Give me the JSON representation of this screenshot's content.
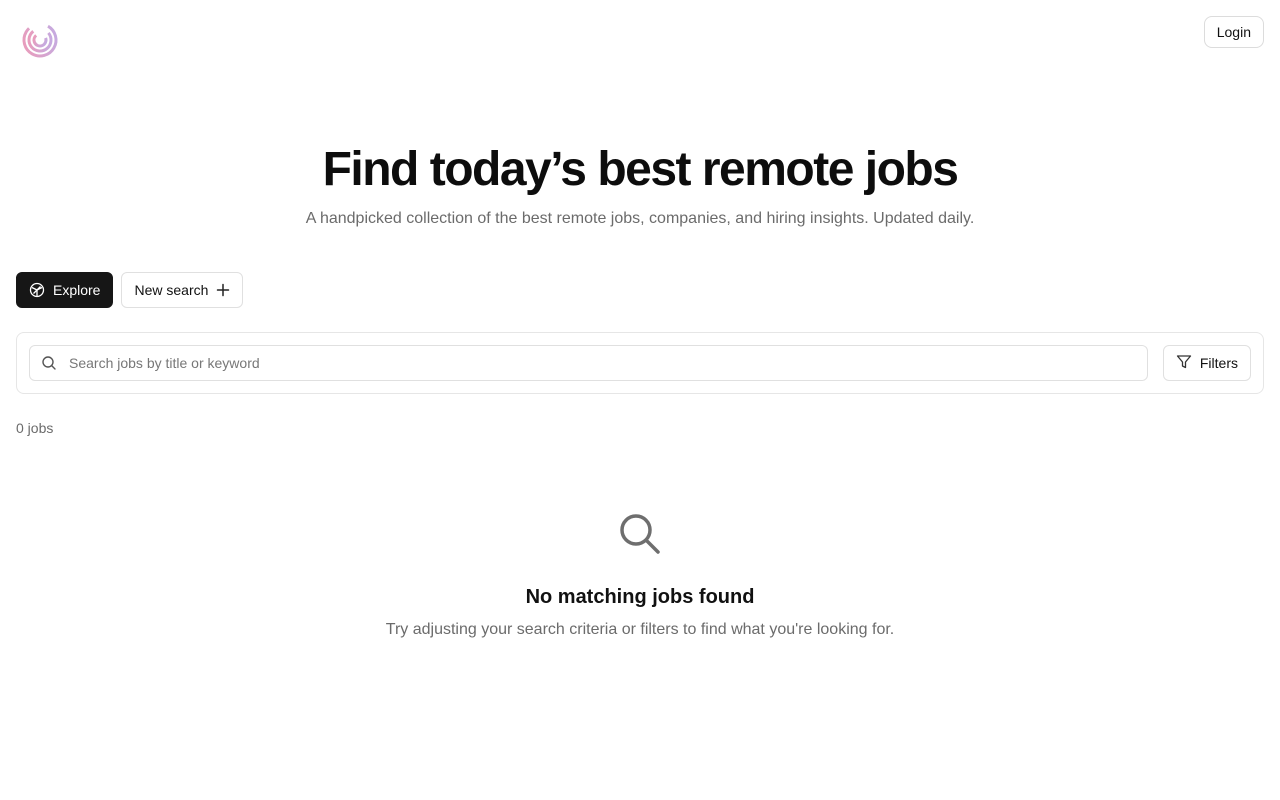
{
  "header": {
    "logo_icon": "concentric-swirl-logo",
    "login_label": "Login"
  },
  "hero": {
    "title": "Find today’s best remote jobs",
    "subtitle": "A handpicked collection of the best remote jobs, companies, and hiring insights. Updated daily."
  },
  "tabs": [
    {
      "label": "Explore",
      "icon": "compass-icon",
      "active": true
    },
    {
      "label": "New search",
      "icon": "plus-icon",
      "active": false
    }
  ],
  "search": {
    "placeholder": "Search jobs by title or keyword",
    "value": "",
    "icon": "search-icon",
    "filters_label": "Filters",
    "filters_icon": "funnel-icon"
  },
  "results": {
    "count_label": "0 jobs"
  },
  "empty_state": {
    "icon": "search-icon",
    "title": "No matching jobs found",
    "description": "Try adjusting your search criteria or filters to find what you're looking for."
  },
  "colors": {
    "logo_pink": "#e79ab5",
    "logo_lavender": "#c6a8e0",
    "active_tab_bg": "#161616",
    "muted_text": "#6b6b6b",
    "border": "#e0e0e0"
  }
}
